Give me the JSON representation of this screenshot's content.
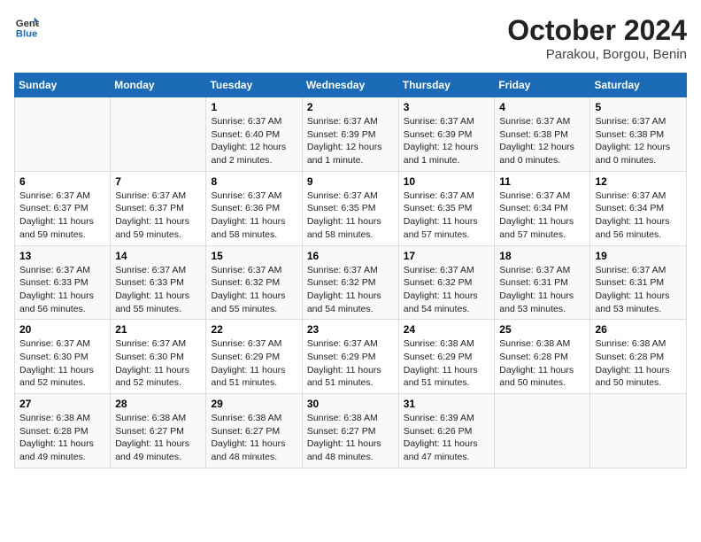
{
  "header": {
    "logo": {
      "line1": "General",
      "line2": "Blue"
    },
    "title": "October 2024",
    "subtitle": "Parakou, Borgou, Benin"
  },
  "days_of_week": [
    "Sunday",
    "Monday",
    "Tuesday",
    "Wednesday",
    "Thursday",
    "Friday",
    "Saturday"
  ],
  "weeks": [
    [
      {
        "day": "",
        "info": ""
      },
      {
        "day": "",
        "info": ""
      },
      {
        "day": "1",
        "info": "Sunrise: 6:37 AM\nSunset: 6:40 PM\nDaylight: 12 hours\nand 2 minutes."
      },
      {
        "day": "2",
        "info": "Sunrise: 6:37 AM\nSunset: 6:39 PM\nDaylight: 12 hours\nand 1 minute."
      },
      {
        "day": "3",
        "info": "Sunrise: 6:37 AM\nSunset: 6:39 PM\nDaylight: 12 hours\nand 1 minute."
      },
      {
        "day": "4",
        "info": "Sunrise: 6:37 AM\nSunset: 6:38 PM\nDaylight: 12 hours\nand 0 minutes."
      },
      {
        "day": "5",
        "info": "Sunrise: 6:37 AM\nSunset: 6:38 PM\nDaylight: 12 hours\nand 0 minutes."
      }
    ],
    [
      {
        "day": "6",
        "info": "Sunrise: 6:37 AM\nSunset: 6:37 PM\nDaylight: 11 hours\nand 59 minutes."
      },
      {
        "day": "7",
        "info": "Sunrise: 6:37 AM\nSunset: 6:37 PM\nDaylight: 11 hours\nand 59 minutes."
      },
      {
        "day": "8",
        "info": "Sunrise: 6:37 AM\nSunset: 6:36 PM\nDaylight: 11 hours\nand 58 minutes."
      },
      {
        "day": "9",
        "info": "Sunrise: 6:37 AM\nSunset: 6:35 PM\nDaylight: 11 hours\nand 58 minutes."
      },
      {
        "day": "10",
        "info": "Sunrise: 6:37 AM\nSunset: 6:35 PM\nDaylight: 11 hours\nand 57 minutes."
      },
      {
        "day": "11",
        "info": "Sunrise: 6:37 AM\nSunset: 6:34 PM\nDaylight: 11 hours\nand 57 minutes."
      },
      {
        "day": "12",
        "info": "Sunrise: 6:37 AM\nSunset: 6:34 PM\nDaylight: 11 hours\nand 56 minutes."
      }
    ],
    [
      {
        "day": "13",
        "info": "Sunrise: 6:37 AM\nSunset: 6:33 PM\nDaylight: 11 hours\nand 56 minutes."
      },
      {
        "day": "14",
        "info": "Sunrise: 6:37 AM\nSunset: 6:33 PM\nDaylight: 11 hours\nand 55 minutes."
      },
      {
        "day": "15",
        "info": "Sunrise: 6:37 AM\nSunset: 6:32 PM\nDaylight: 11 hours\nand 55 minutes."
      },
      {
        "day": "16",
        "info": "Sunrise: 6:37 AM\nSunset: 6:32 PM\nDaylight: 11 hours\nand 54 minutes."
      },
      {
        "day": "17",
        "info": "Sunrise: 6:37 AM\nSunset: 6:32 PM\nDaylight: 11 hours\nand 54 minutes."
      },
      {
        "day": "18",
        "info": "Sunrise: 6:37 AM\nSunset: 6:31 PM\nDaylight: 11 hours\nand 53 minutes."
      },
      {
        "day": "19",
        "info": "Sunrise: 6:37 AM\nSunset: 6:31 PM\nDaylight: 11 hours\nand 53 minutes."
      }
    ],
    [
      {
        "day": "20",
        "info": "Sunrise: 6:37 AM\nSunset: 6:30 PM\nDaylight: 11 hours\nand 52 minutes."
      },
      {
        "day": "21",
        "info": "Sunrise: 6:37 AM\nSunset: 6:30 PM\nDaylight: 11 hours\nand 52 minutes."
      },
      {
        "day": "22",
        "info": "Sunrise: 6:37 AM\nSunset: 6:29 PM\nDaylight: 11 hours\nand 51 minutes."
      },
      {
        "day": "23",
        "info": "Sunrise: 6:37 AM\nSunset: 6:29 PM\nDaylight: 11 hours\nand 51 minutes."
      },
      {
        "day": "24",
        "info": "Sunrise: 6:38 AM\nSunset: 6:29 PM\nDaylight: 11 hours\nand 51 minutes."
      },
      {
        "day": "25",
        "info": "Sunrise: 6:38 AM\nSunset: 6:28 PM\nDaylight: 11 hours\nand 50 minutes."
      },
      {
        "day": "26",
        "info": "Sunrise: 6:38 AM\nSunset: 6:28 PM\nDaylight: 11 hours\nand 50 minutes."
      }
    ],
    [
      {
        "day": "27",
        "info": "Sunrise: 6:38 AM\nSunset: 6:28 PM\nDaylight: 11 hours\nand 49 minutes."
      },
      {
        "day": "28",
        "info": "Sunrise: 6:38 AM\nSunset: 6:27 PM\nDaylight: 11 hours\nand 49 minutes."
      },
      {
        "day": "29",
        "info": "Sunrise: 6:38 AM\nSunset: 6:27 PM\nDaylight: 11 hours\nand 48 minutes."
      },
      {
        "day": "30",
        "info": "Sunrise: 6:38 AM\nSunset: 6:27 PM\nDaylight: 11 hours\nand 48 minutes."
      },
      {
        "day": "31",
        "info": "Sunrise: 6:39 AM\nSunset: 6:26 PM\nDaylight: 11 hours\nand 47 minutes."
      },
      {
        "day": "",
        "info": ""
      },
      {
        "day": "",
        "info": ""
      }
    ]
  ]
}
